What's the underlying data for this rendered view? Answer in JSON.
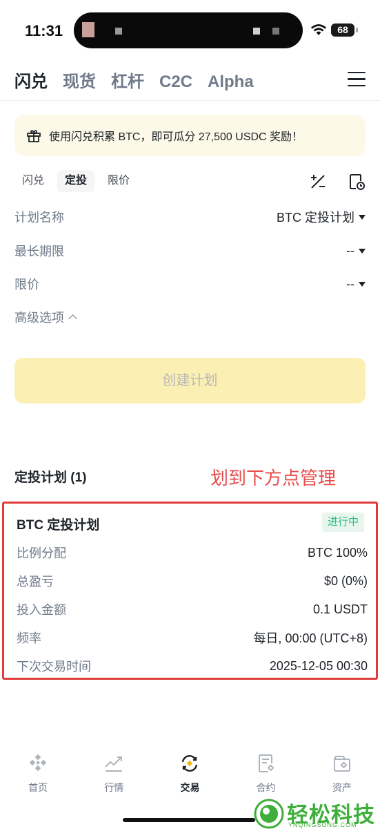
{
  "status_bar": {
    "time": "11:31",
    "battery": "68"
  },
  "top_tabs": [
    {
      "label": "闪兑",
      "active": true
    },
    {
      "label": "现货",
      "active": false
    },
    {
      "label": "杠杆",
      "active": false
    },
    {
      "label": "C2C",
      "active": false
    },
    {
      "label": "Alpha",
      "active": false
    }
  ],
  "banner": {
    "text": "使用闪兑积累 BTC，即可瓜分 27,500 USDC 奖励！"
  },
  "sub_tabs": [
    {
      "label": "闪兑",
      "active": false
    },
    {
      "label": "定投",
      "active": true
    },
    {
      "label": "限价",
      "active": false
    }
  ],
  "form": {
    "plan_name": {
      "label": "计划名称",
      "value": "BTC 定投计划"
    },
    "max_period": {
      "label": "最长期限",
      "value": "--"
    },
    "limit_price": {
      "label": "限价",
      "value": "--"
    },
    "advanced_label": "高级选项"
  },
  "create_button": "创建计划",
  "plans_section": {
    "title": "定投计划 (1)"
  },
  "annotation": "划到下方点管理",
  "plan_card": {
    "name": "BTC 定投计划",
    "status": "进行中",
    "rows": [
      {
        "label": "比例分配",
        "value": "BTC 100%"
      },
      {
        "label": "总盈亏",
        "value": "$0 (0%)"
      },
      {
        "label": "投入金额",
        "value": "0.1 USDT"
      },
      {
        "label": "频率",
        "value": "每日, 00:00 (UTC+8)"
      },
      {
        "label": "下次交易时间",
        "value": "2025-12-05 00:30"
      }
    ]
  },
  "bottom_nav": [
    {
      "label": "首页",
      "icon": "home-icon",
      "active": false
    },
    {
      "label": "行情",
      "icon": "markets-icon",
      "active": false
    },
    {
      "label": "交易",
      "icon": "trade-icon",
      "active": true
    },
    {
      "label": "合约",
      "icon": "futures-icon",
      "active": false
    },
    {
      "label": "资产",
      "icon": "assets-icon",
      "active": false
    }
  ],
  "watermark": {
    "text": "轻松科技",
    "sub": "YNQINGSONG.COM"
  },
  "colors": {
    "accent": "#fcd535",
    "annotation": "#e84b4b",
    "positive": "#2ebd85"
  }
}
